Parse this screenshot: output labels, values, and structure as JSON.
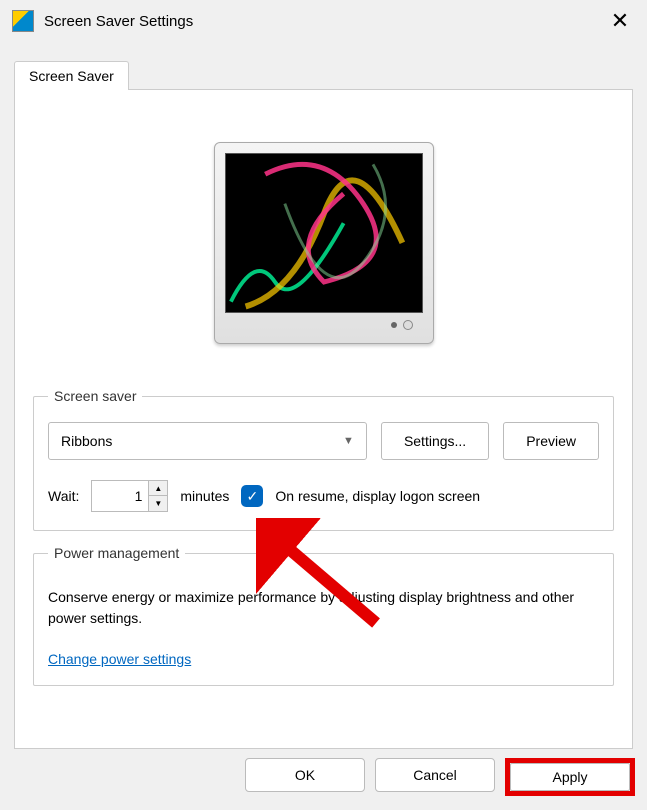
{
  "titlebar": {
    "title": "Screen Saver Settings"
  },
  "tab": {
    "label": "Screen Saver"
  },
  "screensaver_group": {
    "legend": "Screen saver",
    "selected": "Ribbons",
    "settings_button": "Settings...",
    "preview_button": "Preview",
    "wait_label": "Wait:",
    "wait_value": "1",
    "minutes_label": "minutes",
    "checkbox_checked": true,
    "checkbox_label": "On resume, display logon screen"
  },
  "power_group": {
    "legend": "Power management",
    "description": "Conserve energy or maximize performance by adjusting display brightness and other power settings.",
    "link": "Change power settings"
  },
  "dialog": {
    "ok": "OK",
    "cancel": "Cancel",
    "apply": "Apply"
  }
}
